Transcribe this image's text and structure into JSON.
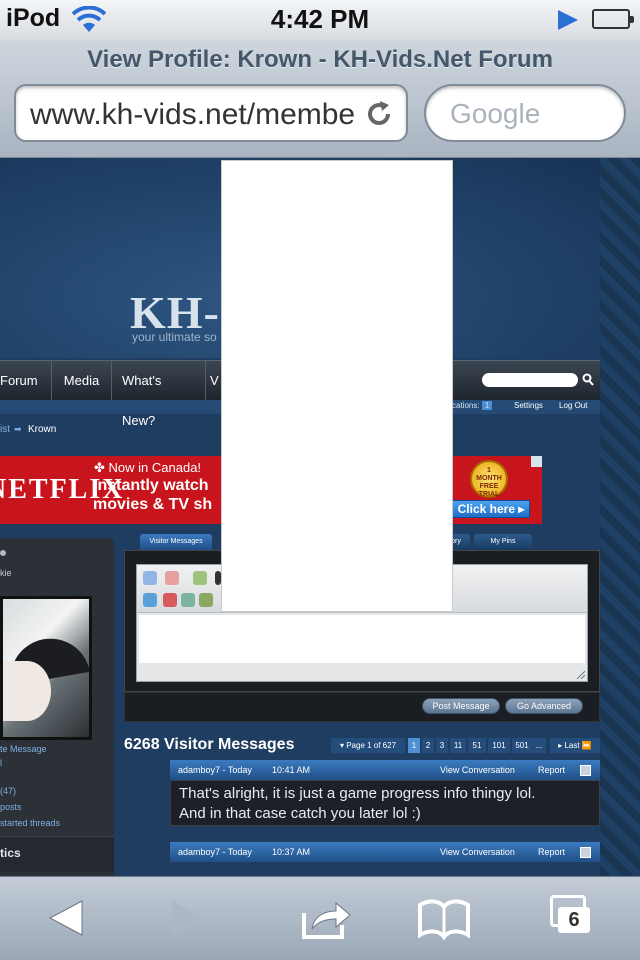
{
  "status_bar": {
    "carrier": "iPod",
    "time": "4:42 PM"
  },
  "safari": {
    "page_title": "View Profile: Krown - KH-Vids.Net Forum",
    "url": "www.kh-vids.net/membe",
    "search_placeholder": "Google",
    "tabs_count": "6"
  },
  "site": {
    "logo": "KH-",
    "tagline": "your ultimate so",
    "nav": [
      "Forum",
      "Media",
      "What's New?",
      "V"
    ],
    "locations_label": "cations:",
    "locations_count": "1",
    "settings": "Settings",
    "logout": "Log Out",
    "breadcrumb_list": "ist",
    "breadcrumb_current": "Krown"
  },
  "ad": {
    "brand": "NETFLIX",
    "canada": "Now in Canada!",
    "line1": "Instantly watch",
    "line2": "movies & TV sh",
    "trial_line1": "1",
    "trial_line2": "MONTH",
    "trial_line3": "FREE",
    "trial_line4": "TRIAL",
    "cta": "Click here"
  },
  "sidebar": {
    "rank": "kie",
    "links": [
      "te Message",
      "(47)",
      "posts",
      "started threads"
    ],
    "stats_title": "tics"
  },
  "tabs": [
    "Visitor Messages",
    "tory",
    "My Pins"
  ],
  "buttons": {
    "post": "Post Message",
    "advanced": "Go Advanced"
  },
  "visitor_messages": {
    "title": "6268 Visitor Messages",
    "pager": [
      "Page 1 of 627",
      "1",
      "2",
      "3",
      "11",
      "51",
      "101",
      "501",
      "...",
      "Last"
    ],
    "messages": [
      {
        "user": "adamboy7 - Today",
        "time": "10:41 AM",
        "view": "View Conversation",
        "report": "Report",
        "text_line1": "That's alright, it is just a game progress info thingy lol.",
        "text_line2": "And in that case catch you later lol :)"
      },
      {
        "user": "adamboy7 - Today",
        "time": "10:37 AM",
        "view": "View Conversation",
        "report": "Report"
      }
    ]
  },
  "colors": {
    "accent": "#2a6fd6",
    "ad_red": "#c8141c",
    "forum_blue": "#1f3d60"
  }
}
